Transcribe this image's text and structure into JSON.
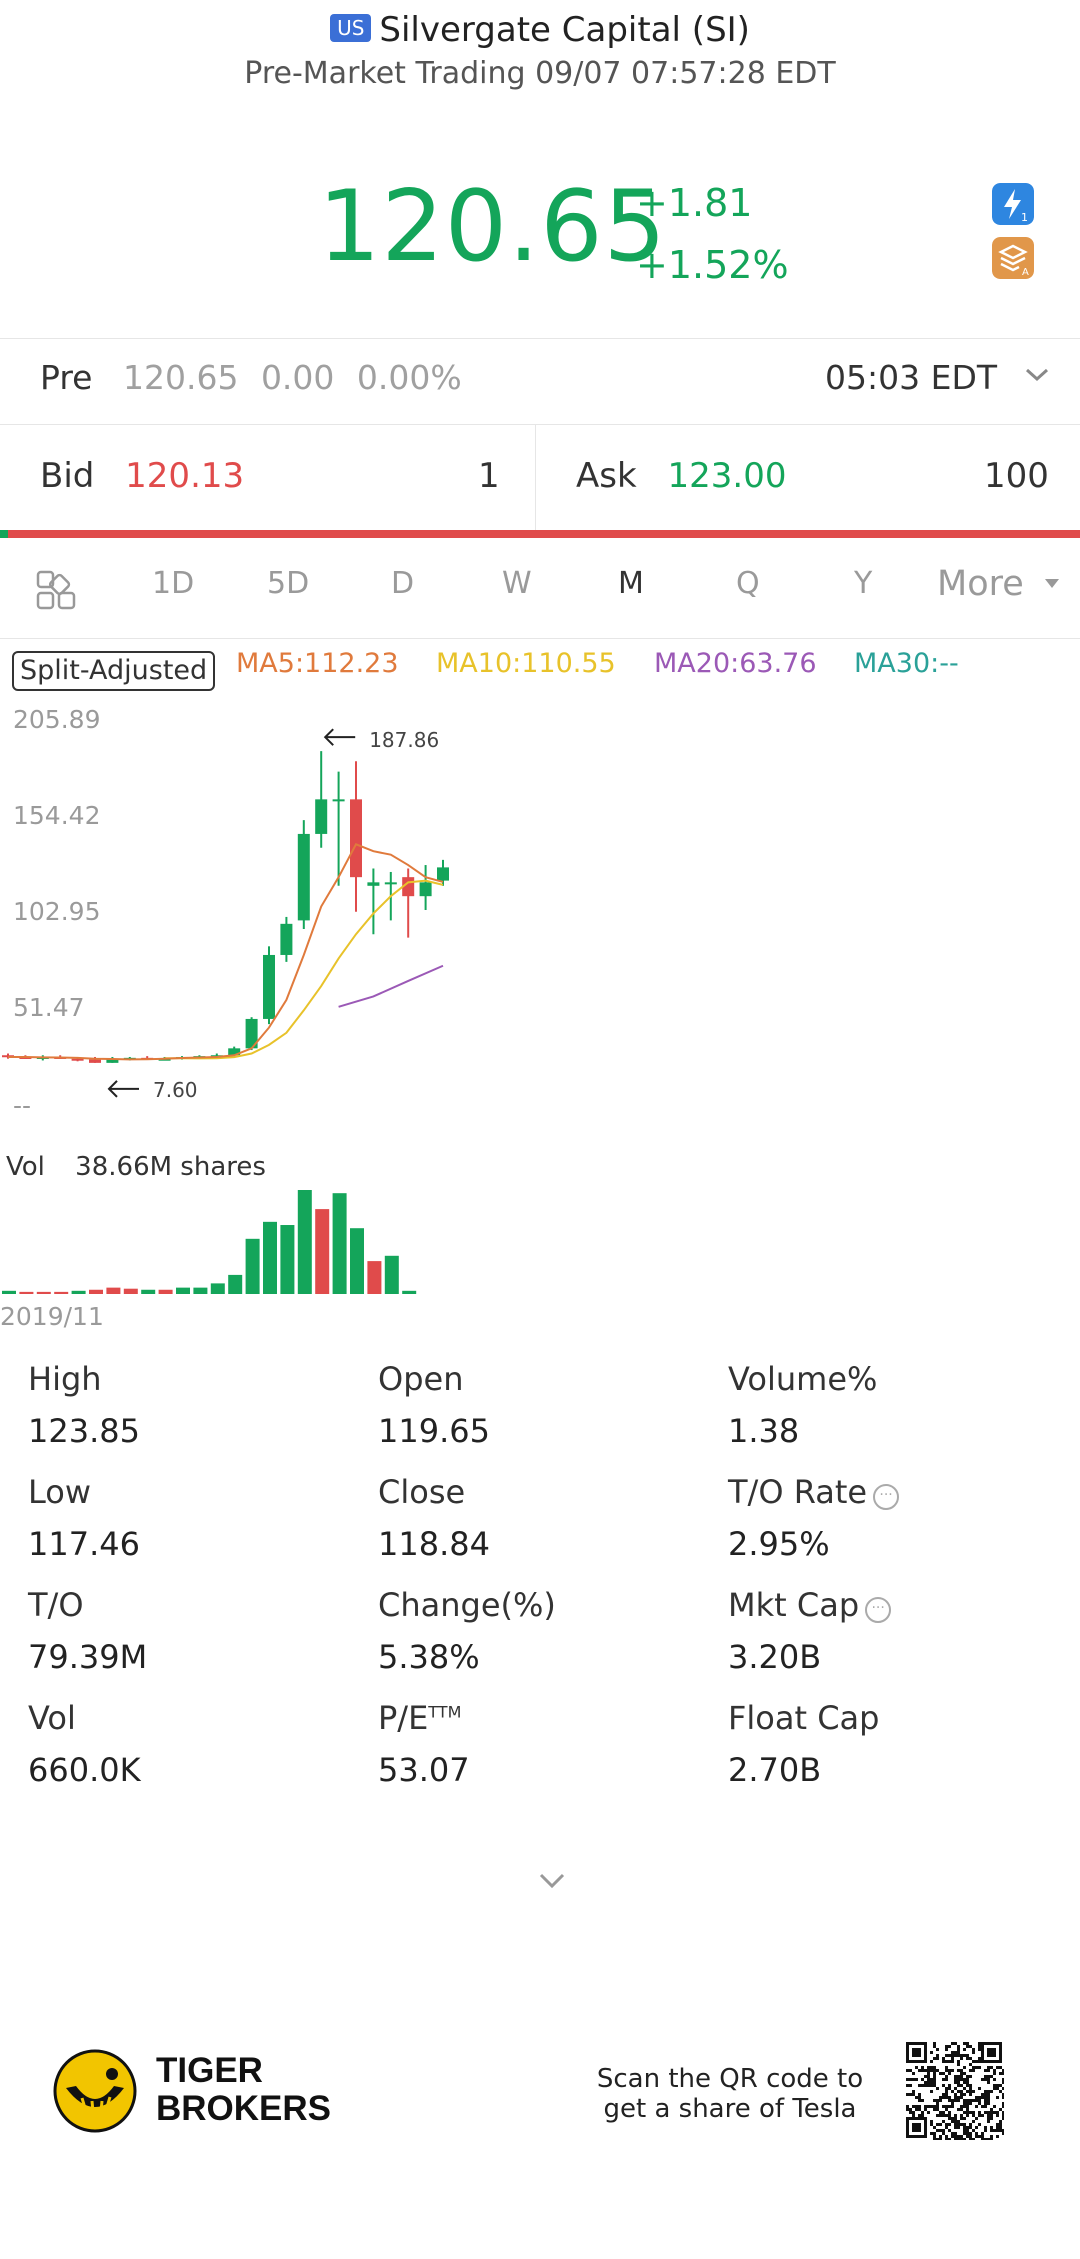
{
  "header": {
    "market_badge": "US",
    "title": "Silvergate Capital (SI)",
    "subtitle": "Pre-Market Trading 09/07 07:57:28 EDT"
  },
  "quote": {
    "price": "120.65",
    "change": "+1.81",
    "change_pct": "+1.52%",
    "color_up": "#14a55a",
    "color_down": "#e04b4b"
  },
  "icons": {
    "lightning": "lightning-icon",
    "layers": "layers-icon"
  },
  "pre": {
    "label": "Pre",
    "price": "120.65",
    "change": "0.00",
    "pct": "0.00%",
    "time": "05:03 EDT"
  },
  "bidask": {
    "bid_label": "Bid",
    "bid_price": "120.13",
    "bid_qty": "1",
    "ask_label": "Ask",
    "ask_price": "123.00",
    "ask_qty": "100"
  },
  "tabs": [
    {
      "label": "1D"
    },
    {
      "label": "5D"
    },
    {
      "label": "D"
    },
    {
      "label": "W"
    },
    {
      "label": "M"
    },
    {
      "label": "Q"
    },
    {
      "label": "Y"
    },
    {
      "label": "More"
    }
  ],
  "active_tab": "M",
  "ma": {
    "split_label": "Split-Adjusted",
    "ma5": "MA5:112.23",
    "ma10": "MA10:110.55",
    "ma20": "MA20:63.76",
    "ma30": "MA30:--",
    "colors": {
      "ma5": "#e07a3c",
      "ma10": "#e8c22a",
      "ma20": "#9b59b6",
      "ma30": "#2aa198"
    }
  },
  "chart_data": {
    "type": "candlestick",
    "y_axis_labels": [
      "205.89",
      "154.42",
      "102.95",
      "51.47",
      "--"
    ],
    "ylim": [
      0,
      205.89
    ],
    "max_label": "187.86",
    "min_label": "7.60",
    "candles": [
      {
        "o": 12,
        "h": 13,
        "l": 10,
        "c": 11
      },
      {
        "o": 11,
        "h": 12,
        "l": 10,
        "c": 10.5
      },
      {
        "o": 10.5,
        "h": 12,
        "l": 9,
        "c": 11
      },
      {
        "o": 11,
        "h": 12,
        "l": 10,
        "c": 10
      },
      {
        "o": 10,
        "h": 11,
        "l": 8.5,
        "c": 9
      },
      {
        "o": 9.5,
        "h": 11,
        "l": 7.6,
        "c": 7.6
      },
      {
        "o": 7.6,
        "h": 11,
        "l": 7.6,
        "c": 10
      },
      {
        "o": 10,
        "h": 11,
        "l": 9,
        "c": 10.5
      },
      {
        "o": 10.5,
        "h": 11.5,
        "l": 9.5,
        "c": 10
      },
      {
        "o": 10,
        "h": 11,
        "l": 9,
        "c": 10
      },
      {
        "o": 10,
        "h": 11.5,
        "l": 9.5,
        "c": 11
      },
      {
        "o": 11,
        "h": 12,
        "l": 10,
        "c": 11.5
      },
      {
        "o": 11,
        "h": 13,
        "l": 10.5,
        "c": 12
      },
      {
        "o": 12,
        "h": 17,
        "l": 11.5,
        "c": 16
      },
      {
        "o": 16,
        "h": 34,
        "l": 15,
        "c": 33
      },
      {
        "o": 33,
        "h": 75,
        "l": 30,
        "c": 70
      },
      {
        "o": 70,
        "h": 92,
        "l": 66,
        "c": 88
      },
      {
        "o": 90,
        "h": 148,
        "l": 85,
        "c": 140
      },
      {
        "o": 140,
        "h": 187.86,
        "l": 132,
        "c": 160
      },
      {
        "o": 160,
        "h": 176,
        "l": 110,
        "c": 160
      },
      {
        "o": 160,
        "h": 182,
        "l": 95,
        "c": 115
      },
      {
        "o": 110,
        "h": 120,
        "l": 82,
        "c": 112
      },
      {
        "o": 112,
        "h": 118,
        "l": 90,
        "c": 112
      },
      {
        "o": 115,
        "h": 120,
        "l": 80,
        "c": 104
      },
      {
        "o": 104,
        "h": 122,
        "l": 96,
        "c": 112
      },
      {
        "o": 113,
        "h": 125,
        "l": 110,
        "c": 120.65
      }
    ],
    "ma5": [
      11,
      11,
      10.8,
      10.7,
      10.5,
      10,
      9.8,
      9.6,
      9.7,
      10,
      10.4,
      10.7,
      11,
      12,
      16,
      28,
      44,
      70,
      98,
      115,
      134,
      130,
      128,
      122,
      115,
      112.23
    ],
    "ma10": [
      null,
      null,
      null,
      null,
      null,
      null,
      null,
      null,
      null,
      10.3,
      10.3,
      10.2,
      10.3,
      10.9,
      13,
      18,
      25,
      38,
      52,
      68,
      82,
      94,
      104,
      112,
      113,
      110.55
    ],
    "ma20": [
      null,
      null,
      null,
      null,
      null,
      null,
      null,
      null,
      null,
      null,
      null,
      null,
      null,
      null,
      null,
      null,
      null,
      null,
      null,
      40,
      null,
      46,
      null,
      55,
      null,
      63.76
    ],
    "volume_label": "Vol",
    "volume_total": "38.66M shares",
    "volume": [
      0.3,
      0.2,
      0.2,
      0.2,
      0.3,
      0.4,
      0.6,
      0.5,
      0.4,
      0.4,
      0.6,
      0.6,
      1.0,
      1.8,
      5.2,
      6.8,
      6.5,
      9.8,
      8.0,
      9.5,
      6.2,
      3.1,
      3.6,
      0.3
    ],
    "volume_dir": [
      "up",
      "down",
      "down",
      "down",
      "up",
      "down",
      "down",
      "down",
      "up",
      "down",
      "up",
      "up",
      "up",
      "up",
      "up",
      "up",
      "up",
      "up",
      "down",
      "up",
      "up",
      "down",
      "up",
      "up"
    ],
    "x_start_label": "2019/11"
  },
  "stats": [
    {
      "label": "High",
      "value": "123.85"
    },
    {
      "label": "Open",
      "value": "119.65"
    },
    {
      "label": "Volume%",
      "value": "1.38"
    },
    {
      "label": "Low",
      "value": "117.46"
    },
    {
      "label": "Close",
      "value": "118.84"
    },
    {
      "label": "T/O Rate",
      "value": "2.95%",
      "info": true
    },
    {
      "label": "T/O",
      "value": "79.39M"
    },
    {
      "label": "Change(%)",
      "value": "5.38%"
    },
    {
      "label": "Mkt Cap",
      "value": "3.20B",
      "info": true
    },
    {
      "label": "Vol",
      "value": "660.0K"
    },
    {
      "label": "P/E",
      "sup": "TTM",
      "value": "53.07"
    },
    {
      "label": "Float Cap",
      "value": "2.70B"
    }
  ],
  "footer": {
    "brand_line1": "TIGER",
    "brand_line2": "BROKERS",
    "qr_line1": "Scan the QR code to",
    "qr_line2": "get a share of Tesla"
  }
}
